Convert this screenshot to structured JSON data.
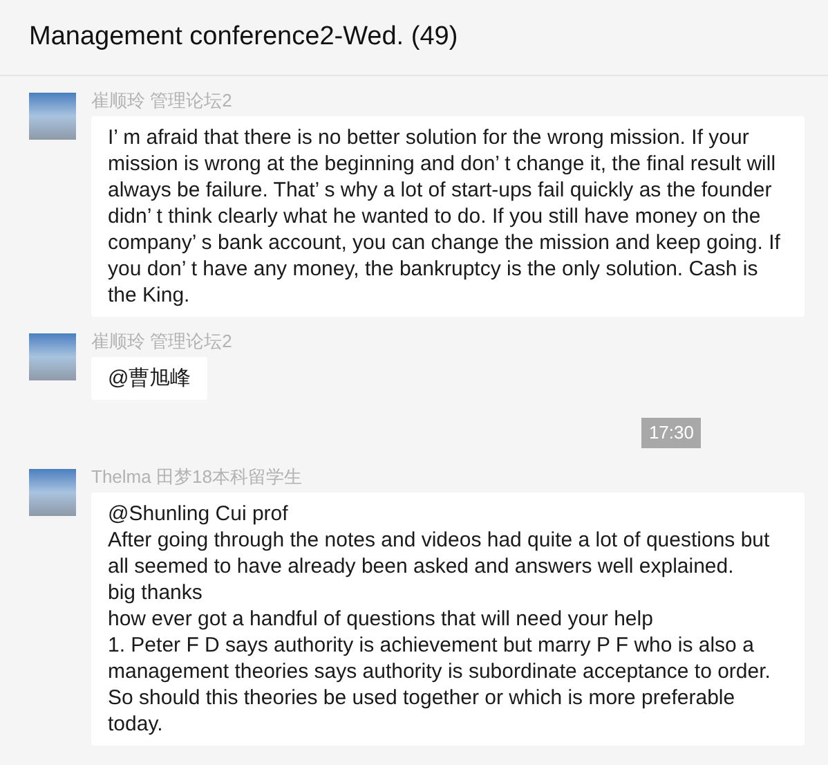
{
  "window": {
    "title": "Management conference2-Wed. (49)"
  },
  "items": [
    {
      "kind": "message",
      "sender": "崔顺玲 管理论坛2",
      "lines": [
        "I’ m afraid that there is no better solution for the wrong mission. If your mission is wrong at the beginning and don’ t change it, the final result will always be failure. That’ s why a lot of start-ups fail quickly as the founder didn’ t think clearly what he wanted to do. If you still have money on the company’ s bank account, you can change the mission and keep going. If you don’ t have any money, the bankruptcy is the only solution. Cash is the King."
      ]
    },
    {
      "kind": "message",
      "sender": "崔顺玲 管理论坛2",
      "lines": [
        "@曹旭峰"
      ]
    },
    {
      "kind": "time",
      "text": "17:30"
    },
    {
      "kind": "message",
      "sender": "Thelma 田梦18本科留学生",
      "lines": [
        "@Shunling Cui  prof",
        "After going through the notes and videos had quite a lot of questions but all seemed to have already been asked and answers well explained.",
        "big thanks",
        "how ever got a handful of questions that will need your  help",
        "1. Peter F D says authority is achievement but marry P F who is also a management theories says authority is subordinate acceptance to order. So should this theories be used together or which is more preferable today."
      ]
    }
  ]
}
